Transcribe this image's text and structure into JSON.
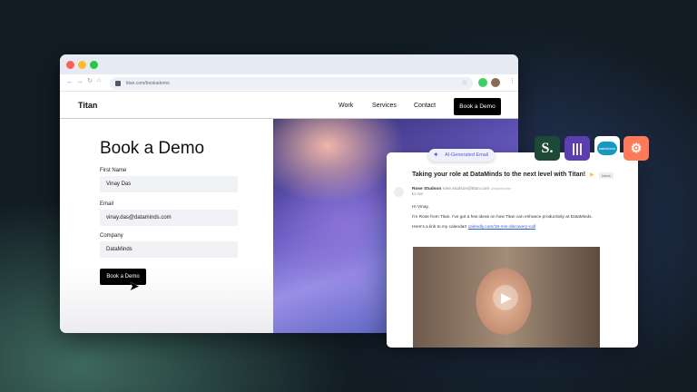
{
  "browser": {
    "url": "titan.com/bookademo"
  },
  "site": {
    "brand": "Titan",
    "nav": [
      "Work",
      "Services",
      "Contact"
    ],
    "cta": "Book a Demo"
  },
  "form": {
    "title": "Book a Demo",
    "fields": [
      {
        "label": "First Name",
        "value": "Vinay Das"
      },
      {
        "label": "Email",
        "value": "vinay.das@dataminds.com"
      },
      {
        "label": "Company",
        "value": "DataMinds"
      }
    ],
    "submit": "Book a Demo"
  },
  "email": {
    "badge": "AI-Generated Email",
    "subject": "Taking your role at DataMinds to the next level with Titan!",
    "tag": "Inbox",
    "sender": "Rose Studson",
    "sender_email": "rose.studson@titan.com",
    "unsubscribe": "Unsubscribe",
    "to": "to me",
    "greeting": "Hi Vinay,",
    "body": "I'm Rose from Titan. I've got a few ideas on how Titan can enhance productivity at DataMinds.",
    "link_prefix": "Here's a link to my calendar!",
    "link": "calendly.com/15-min-discovery-call"
  },
  "integrations": [
    {
      "name": "S.",
      "color": "#1d4a37"
    },
    {
      "name": "",
      "color": "#5b3fb0"
    },
    {
      "name": "salesforce",
      "color": "#ffffff"
    },
    {
      "name": "hubspot",
      "color": "#ff7a59"
    }
  ]
}
